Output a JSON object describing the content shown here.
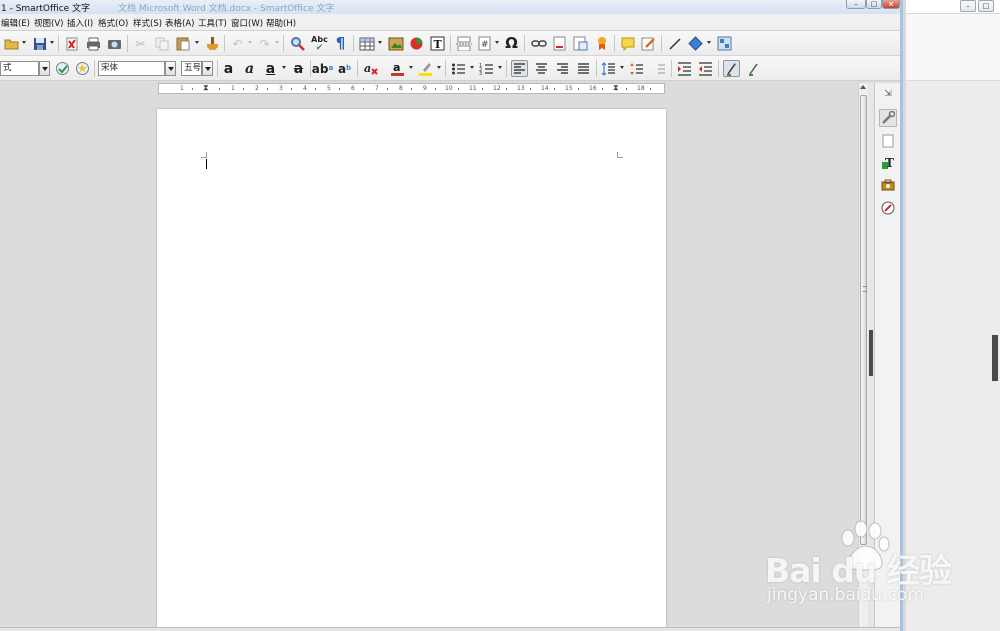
{
  "window": {
    "title": "1 - SmartOffice 文字",
    "ghost_title": "文档 Microsoft Word 文档.docx - SmartOffice 文字",
    "controls": {
      "minimize": "–",
      "maximize": "□",
      "close": "×"
    }
  },
  "menu": {
    "items": [
      "编辑(E)",
      "视图(V)",
      "插入(I)",
      "格式(O)",
      "样式(S)",
      "表格(A)",
      "工具(T)",
      "窗口(W)",
      "帮助(H)"
    ]
  },
  "toolbar1": {
    "icons": [
      "open-icon",
      "save-icon",
      "export-pdf-icon",
      "print-icon",
      "print-preview-icon",
      "cut-icon",
      "copy-icon",
      "paste-icon",
      "clone-formatting-icon",
      "undo-icon",
      "redo-icon",
      "find-replace-icon",
      "spellcheck-icon",
      "formatting-marks-icon",
      "table-icon",
      "image-icon",
      "chart-icon",
      "textbox-icon",
      "page-break-icon",
      "field-icon",
      "special-character-icon",
      "hyperlink-icon",
      "footnote-icon",
      "endnote-icon",
      "bookmark-icon",
      "comment-icon",
      "track-changes-icon",
      "line-icon",
      "shapes-icon",
      "draw-functions-icon"
    ],
    "spellcheck_label": "Abc",
    "pilcrow": "¶",
    "omega": "Ω"
  },
  "toolbar2": {
    "paragraph_style": "式",
    "font_name": "宋体",
    "font_size": "五号",
    "bold_glyph": "a",
    "italic_glyph": "a",
    "underline_glyph": "a",
    "strike_glyph": "a",
    "superscript_glyph": "ab",
    "subscript_glyph": "a"
  },
  "ruler": {
    "numbers": [
      "1",
      "1",
      "2",
      "3",
      "4",
      "5",
      "6",
      "7",
      "8",
      "9",
      "10",
      "11",
      "12",
      "13",
      "14",
      "15",
      "16",
      "18"
    ]
  },
  "watermark": {
    "brand": "Bai du 经验",
    "site": "jingyan.baidu.com"
  },
  "colors": {
    "accent": "#a9c3de",
    "font_color": "#c0392b",
    "highlight": "#f5e400",
    "page": "#ffffff",
    "workspace": "#dcdcdc"
  }
}
